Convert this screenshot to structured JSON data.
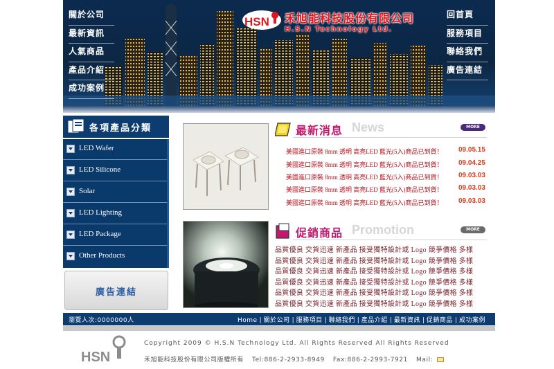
{
  "header": {
    "nav_left": [
      "關於公司",
      "最新資訊",
      "人氣商品",
      "產品介紹",
      "成功案例"
    ],
    "nav_right": [
      "回首頁",
      "服務項目",
      "聯絡我們",
      "廣告連結"
    ],
    "brand_cn": "禾旭能科技股份有限公司",
    "brand_en": "H.S.N Technology Ltd.",
    "logo_text": "HSN"
  },
  "sidebar": {
    "title": "各項產品分類",
    "items": [
      "LED Wafer",
      "LED Silicone",
      "Solar",
      "LED Lighting",
      "LED Package",
      "Other Products"
    ],
    "ad_label": "廣告連結"
  },
  "news": {
    "title_cn": "最新消息",
    "title_en": "News",
    "more": "MORE",
    "items": [
      {
        "title": "美國進口原裝 8mm 透明 高亮LED 藍光(5入)商品已到貨！",
        "date": "09.05.15"
      },
      {
        "title": "美國進口原裝 8mm 透明 高亮LED 藍光(5入)商品已到貨！",
        "date": "09.04.25"
      },
      {
        "title": "美國進口原裝 8mm 透明 高亮LED 藍光(5入)商品已到貨！",
        "date": "09.03.03"
      },
      {
        "title": "美國進口原裝 8mm 透明 高亮LED 藍光(5入)商品已到貨！",
        "date": "09.03.03"
      },
      {
        "title": "美國進口原裝 8mm 透明 高亮LED 藍光(5入)商品已到貨！",
        "date": "09.03.03"
      }
    ]
  },
  "promotion": {
    "title_cn": "促銷商品",
    "title_en": "Promotion",
    "more": "MORE",
    "lines": [
      "品質優良 交貨迅速 新產品 接受獨特設計或 Logo 競爭價格 多樣",
      "品質優良 交貨迅速 新產品 接受獨特設計或 Logo 競爭價格 多樣",
      "品質優良 交貨迅速 新產品 接受獨特設計或 Logo 競爭價格 多樣",
      "品質優良 交貨迅速 新產品 接受獨特設計或 Logo 競爭價格 多樣",
      "品質優良 交貨迅速 新產品 接受獨特設計或 Logo 競爭價格 多樣",
      "品質優良 交貨迅速 新產品 接受獨特設計或 Logo 競爭價格 多樣"
    ]
  },
  "bottom": {
    "visits": "瀏覽人次:0000000人",
    "nav": [
      "Home",
      "關於公司",
      "服務項目",
      "聯絡我們",
      "產品介紹",
      "最新資訊",
      "促銷商品",
      "成功案例"
    ],
    "separator": "|"
  },
  "footer": {
    "logo_text": "HSN",
    "copyright": "Copyright 2009 © H.S.N Technology Ltd. All Rights Reserved  All Rights Reserved",
    "company": "禾旭能科技股份有限公司版權所有",
    "tel": "Tel:886-2-2933-8949",
    "fax": "Fax:886-2-2993-7921",
    "mail_label": "Mail:"
  },
  "colors": {
    "navy": "#0d3d70",
    "brand_red": "#e0161e",
    "news_red": "#b3121c",
    "accent_magenta": "#c3186e"
  },
  "icons": [
    "skyline-image",
    "hsn-logo",
    "category-icon",
    "chevron-down-icon",
    "news-icon",
    "promotion-icon",
    "mail-icon"
  ]
}
